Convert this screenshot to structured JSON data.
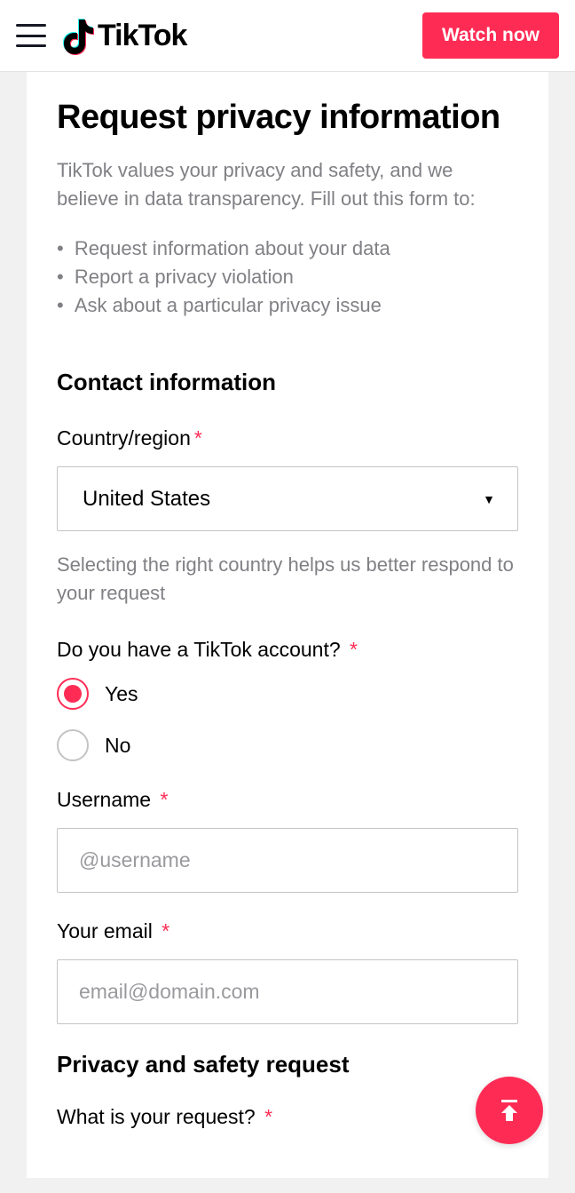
{
  "header": {
    "brand_text": "TikTok",
    "watch_button": "Watch now"
  },
  "page": {
    "title": "Request privacy information",
    "intro": "TikTok values your privacy and safety, and we believe in data transparency. Fill out this form to:",
    "bullets": [
      "Request information about your data",
      "Report a privacy violation",
      "Ask about a particular privacy issue"
    ]
  },
  "contact": {
    "section_title": "Contact information",
    "country_label": "Country/region",
    "country_value": "United States",
    "country_hint": "Selecting the right country helps us better respond to your request",
    "account_label": "Do you have a TikTok account?",
    "yes_label": "Yes",
    "no_label": "No",
    "username_label": "Username",
    "username_placeholder": "@username",
    "email_label": "Your email",
    "email_placeholder": "email@domain.com"
  },
  "request": {
    "section_title": "Privacy and safety request",
    "what_label": "What is your request?"
  }
}
